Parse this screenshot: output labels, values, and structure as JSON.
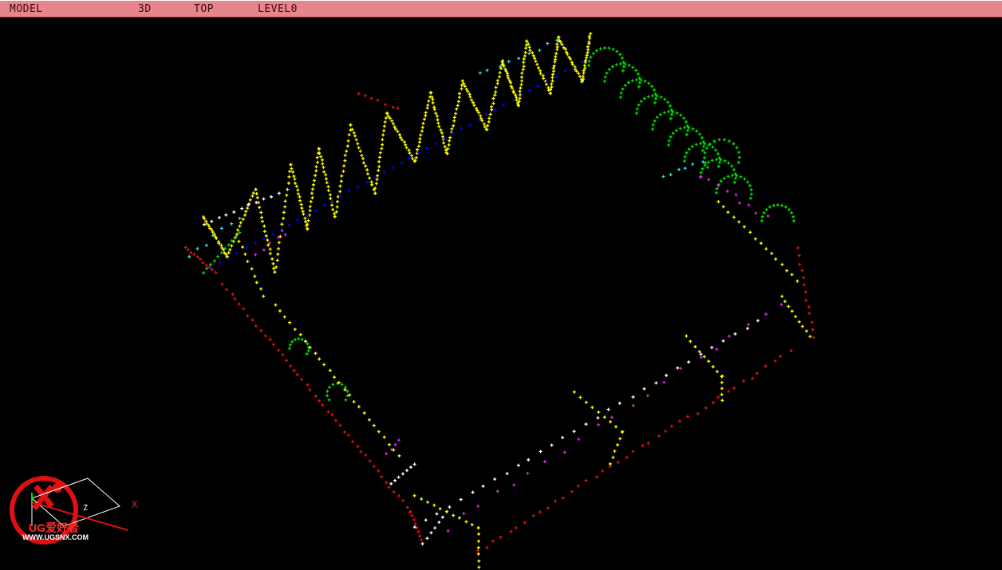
{
  "status_bar": {
    "mode": "MODEL",
    "view": "3D",
    "orientation": "TOP",
    "level": "LEVEL0"
  },
  "triad": {
    "x_label": "X"
  },
  "watermark": {
    "brand": "UG爱好者",
    "url": "WWW.UGSNX.COM"
  },
  "colors": {
    "status_bar_bg": "#e8848c",
    "yellow_path": "#ffff00",
    "green_path": "#00dd00",
    "red_path": "#e01010",
    "blue_path": "#0000ff",
    "cyan_path": "#33dddd",
    "magenta_path": "#dd22dd",
    "white_path": "#ffffff"
  }
}
